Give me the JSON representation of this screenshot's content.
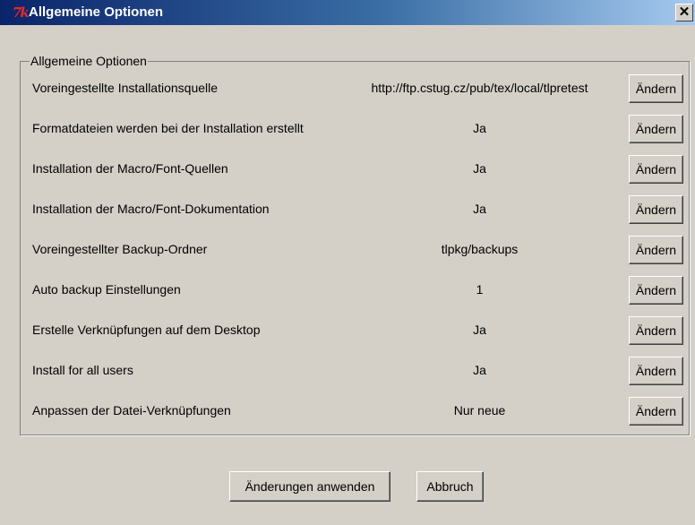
{
  "window": {
    "title": "Allgemeine Optionen",
    "close_glyph": "✕",
    "icon": "tk-icon",
    "icon_text": "7k"
  },
  "group": {
    "legend": "Allgemeine Optionen"
  },
  "options": [
    {
      "label": "Voreingestellte Installationsquelle",
      "value": "http://ftp.cstug.cz/pub/tex/local/tlpretest",
      "button": "Ändern"
    },
    {
      "label": "Formatdateien werden bei der Installation erstellt",
      "value": "Ja",
      "button": "Ändern"
    },
    {
      "label": "Installation der Macro/Font-Quellen",
      "value": "Ja",
      "button": "Ändern"
    },
    {
      "label": "Installation der Macro/Font-Dokumentation",
      "value": "Ja",
      "button": "Ändern"
    },
    {
      "label": "Voreingestellter Backup-Ordner",
      "value": "tlpkg/backups",
      "button": "Ändern"
    },
    {
      "label": "Auto backup Einstellungen",
      "value": "1",
      "button": "Ändern"
    },
    {
      "label": "Erstelle Verknüpfungen auf dem Desktop",
      "value": "Ja",
      "button": "Ändern"
    },
    {
      "label": "Install for all users",
      "value": "Ja",
      "button": "Ändern"
    },
    {
      "label": "Anpassen der Datei-Verknüpfungen",
      "value": "Nur neue",
      "button": "Ändern"
    }
  ],
  "footer": {
    "apply_label": "Änderungen anwenden",
    "cancel_label": "Abbruch"
  },
  "colors": {
    "titlebar_start": "#0a246a",
    "titlebar_end": "#a6caf0",
    "face": "#d4d0c8",
    "icon_red": "#e8272a"
  }
}
